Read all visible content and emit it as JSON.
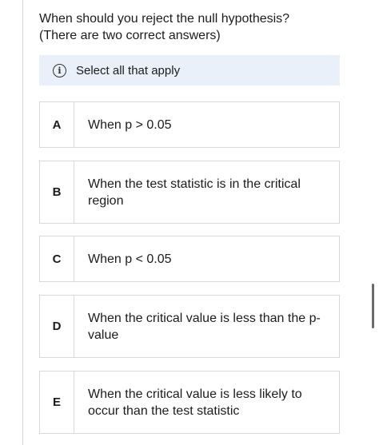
{
  "question": {
    "line1": "When should you reject the null hypothesis?",
    "line2": "(There are two correct answers)"
  },
  "hint": {
    "icon": "info-icon",
    "text": "Select all that apply"
  },
  "options": [
    {
      "letter": "A",
      "text": "When p > 0.05"
    },
    {
      "letter": "B",
      "text": "When the test statistic is in the critical region"
    },
    {
      "letter": "C",
      "text": "When p < 0.05"
    },
    {
      "letter": "D",
      "text": "When the critical value is less than the p-value"
    },
    {
      "letter": "E",
      "text": "When the critical value is less likely to occur than the test statistic"
    }
  ],
  "colors": {
    "hint_background": "#e9f0fa",
    "border": "#d9d9d9",
    "text": "#1c1c1c"
  }
}
